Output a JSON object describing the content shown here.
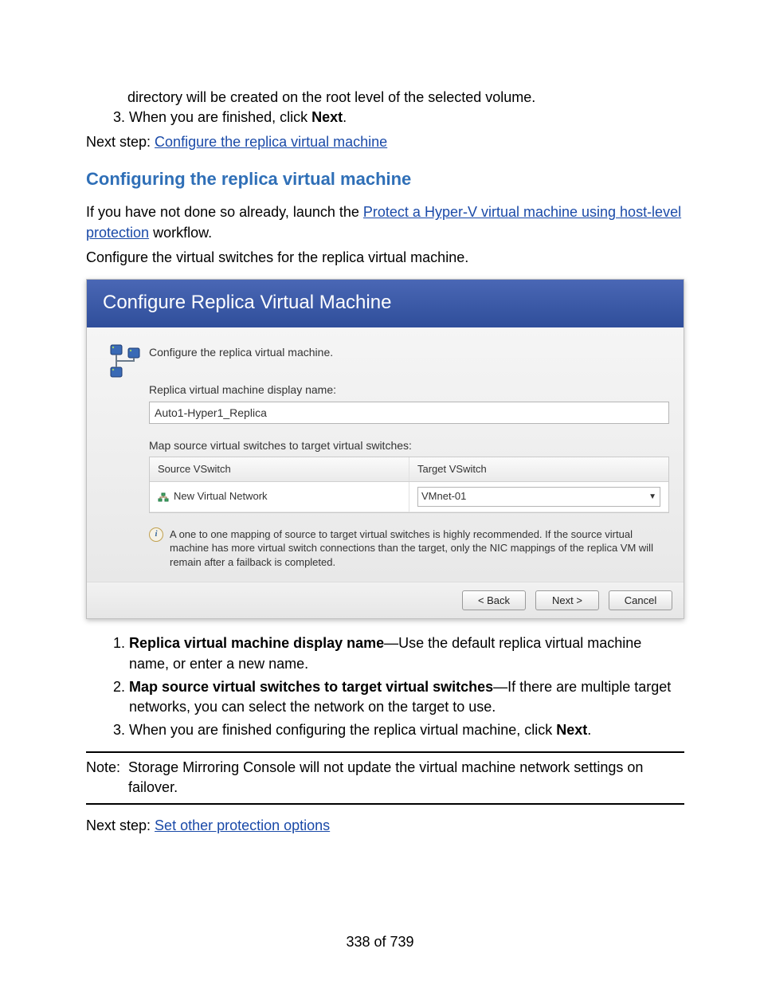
{
  "intro": {
    "bullet_text": "directory will be created on the root level of the selected volume.",
    "step3_prefix": "When you are finished, click ",
    "step3_bold": "Next",
    "step3_suffix": ".",
    "next_label": "Next step: ",
    "next_link": "Configure the replica virtual machine"
  },
  "heading": "Configuring the replica virtual machine",
  "para1": {
    "prefix": "If you have not done so already, launch the ",
    "link": "Protect a Hyper-V virtual machine using host-level protection",
    "suffix": " workflow."
  },
  "para2": "Configure the virtual switches for the replica virtual machine.",
  "dialog": {
    "title": "Configure Replica Virtual Machine",
    "instruct": "Configure the replica virtual machine.",
    "name_label": "Replica virtual machine display name:",
    "name_value": "Auto1-Hyper1_Replica",
    "map_label": "Map source virtual switches to target virtual switches:",
    "col_source": "Source VSwitch",
    "col_target": "Target VSwitch",
    "row_source": "New Virtual Network",
    "row_target": "VMnet-01",
    "info": "A one to one mapping of source to target virtual switches is highly recommended. If the source virtual machine has more virtual switch connections than the target, only the NIC mappings of the replica VM will remain after a failback is completed.",
    "btn_back": "< Back",
    "btn_next": "Next >",
    "btn_cancel": "Cancel"
  },
  "list2": {
    "i1_bold": "Replica virtual machine display name",
    "i1_rest": "—Use the default replica virtual machine name, or enter a new name.",
    "i2_bold": "Map source virtual switches to target virtual switches",
    "i2_rest": "—If there are multiple target networks, you can select the network on the target to use.",
    "i3_prefix": "When you are finished configuring the replica virtual machine, click ",
    "i3_bold": "Next",
    "i3_suffix": "."
  },
  "note": {
    "label": "Note:",
    "text": "Storage Mirroring Console will not update the virtual machine network settings on failover."
  },
  "next2": {
    "label": "Next step: ",
    "link": "Set other protection options"
  },
  "pagenum": "338 of 739"
}
